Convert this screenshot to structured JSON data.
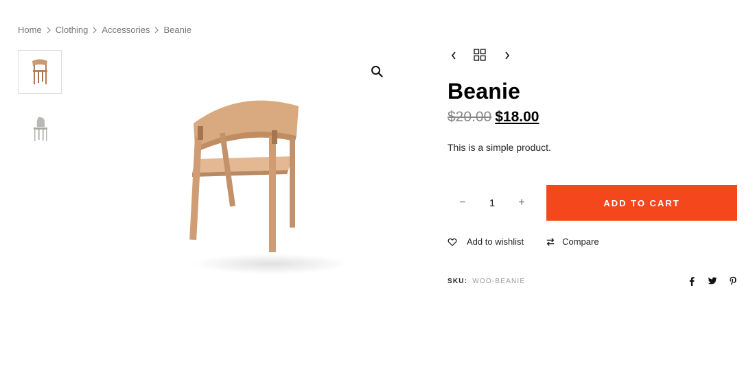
{
  "breadcrumb": {
    "items": [
      "Home",
      "Clothing",
      "Accessories",
      "Beanie"
    ]
  },
  "gallery": {
    "thumbnails": [
      "chair-wood-thumbnail",
      "chair-grey-thumbnail"
    ],
    "active_index": 0,
    "main_image": "wooden-chair-image",
    "zoom_icon": "search-icon"
  },
  "product_nav": {
    "prev_icon": "chevron-left-icon",
    "grid_icon": "grid-icon",
    "next_icon": "chevron-right-icon"
  },
  "product": {
    "title": "Beanie",
    "old_price": "$20.00",
    "price": "$18.00",
    "short_description": "This is a simple product.",
    "quantity": "1",
    "minus_label": "−",
    "plus_label": "+",
    "add_to_cart_label": "ADD TO CART",
    "sku_label": "SKU:",
    "sku_value": "WOO-BEANIE"
  },
  "actions": {
    "wishlist_label": "Add to wishlist",
    "compare_label": "Compare"
  },
  "social": [
    "facebook-icon",
    "twitter-icon",
    "pinterest-icon"
  ],
  "colors": {
    "accent": "#f4481c",
    "text": "#111111",
    "muted": "#777777"
  }
}
